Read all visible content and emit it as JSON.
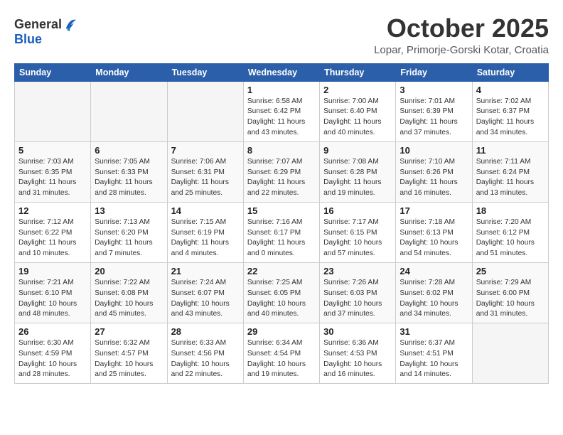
{
  "header": {
    "logo_general": "General",
    "logo_blue": "Blue",
    "month": "October 2025",
    "location": "Lopar, Primorje-Gorski Kotar, Croatia"
  },
  "weekdays": [
    "Sunday",
    "Monday",
    "Tuesday",
    "Wednesday",
    "Thursday",
    "Friday",
    "Saturday"
  ],
  "weeks": [
    [
      {
        "day": "",
        "info": ""
      },
      {
        "day": "",
        "info": ""
      },
      {
        "day": "",
        "info": ""
      },
      {
        "day": "1",
        "info": "Sunrise: 6:58 AM\nSunset: 6:42 PM\nDaylight: 11 hours and 43 minutes."
      },
      {
        "day": "2",
        "info": "Sunrise: 7:00 AM\nSunset: 6:40 PM\nDaylight: 11 hours and 40 minutes."
      },
      {
        "day": "3",
        "info": "Sunrise: 7:01 AM\nSunset: 6:39 PM\nDaylight: 11 hours and 37 minutes."
      },
      {
        "day": "4",
        "info": "Sunrise: 7:02 AM\nSunset: 6:37 PM\nDaylight: 11 hours and 34 minutes."
      }
    ],
    [
      {
        "day": "5",
        "info": "Sunrise: 7:03 AM\nSunset: 6:35 PM\nDaylight: 11 hours and 31 minutes."
      },
      {
        "day": "6",
        "info": "Sunrise: 7:05 AM\nSunset: 6:33 PM\nDaylight: 11 hours and 28 minutes."
      },
      {
        "day": "7",
        "info": "Sunrise: 7:06 AM\nSunset: 6:31 PM\nDaylight: 11 hours and 25 minutes."
      },
      {
        "day": "8",
        "info": "Sunrise: 7:07 AM\nSunset: 6:29 PM\nDaylight: 11 hours and 22 minutes."
      },
      {
        "day": "9",
        "info": "Sunrise: 7:08 AM\nSunset: 6:28 PM\nDaylight: 11 hours and 19 minutes."
      },
      {
        "day": "10",
        "info": "Sunrise: 7:10 AM\nSunset: 6:26 PM\nDaylight: 11 hours and 16 minutes."
      },
      {
        "day": "11",
        "info": "Sunrise: 7:11 AM\nSunset: 6:24 PM\nDaylight: 11 hours and 13 minutes."
      }
    ],
    [
      {
        "day": "12",
        "info": "Sunrise: 7:12 AM\nSunset: 6:22 PM\nDaylight: 11 hours and 10 minutes."
      },
      {
        "day": "13",
        "info": "Sunrise: 7:13 AM\nSunset: 6:20 PM\nDaylight: 11 hours and 7 minutes."
      },
      {
        "day": "14",
        "info": "Sunrise: 7:15 AM\nSunset: 6:19 PM\nDaylight: 11 hours and 4 minutes."
      },
      {
        "day": "15",
        "info": "Sunrise: 7:16 AM\nSunset: 6:17 PM\nDaylight: 11 hours and 0 minutes."
      },
      {
        "day": "16",
        "info": "Sunrise: 7:17 AM\nSunset: 6:15 PM\nDaylight: 10 hours and 57 minutes."
      },
      {
        "day": "17",
        "info": "Sunrise: 7:18 AM\nSunset: 6:13 PM\nDaylight: 10 hours and 54 minutes."
      },
      {
        "day": "18",
        "info": "Sunrise: 7:20 AM\nSunset: 6:12 PM\nDaylight: 10 hours and 51 minutes."
      }
    ],
    [
      {
        "day": "19",
        "info": "Sunrise: 7:21 AM\nSunset: 6:10 PM\nDaylight: 10 hours and 48 minutes."
      },
      {
        "day": "20",
        "info": "Sunrise: 7:22 AM\nSunset: 6:08 PM\nDaylight: 10 hours and 45 minutes."
      },
      {
        "day": "21",
        "info": "Sunrise: 7:24 AM\nSunset: 6:07 PM\nDaylight: 10 hours and 43 minutes."
      },
      {
        "day": "22",
        "info": "Sunrise: 7:25 AM\nSunset: 6:05 PM\nDaylight: 10 hours and 40 minutes."
      },
      {
        "day": "23",
        "info": "Sunrise: 7:26 AM\nSunset: 6:03 PM\nDaylight: 10 hours and 37 minutes."
      },
      {
        "day": "24",
        "info": "Sunrise: 7:28 AM\nSunset: 6:02 PM\nDaylight: 10 hours and 34 minutes."
      },
      {
        "day": "25",
        "info": "Sunrise: 7:29 AM\nSunset: 6:00 PM\nDaylight: 10 hours and 31 minutes."
      }
    ],
    [
      {
        "day": "26",
        "info": "Sunrise: 6:30 AM\nSunset: 4:59 PM\nDaylight: 10 hours and 28 minutes."
      },
      {
        "day": "27",
        "info": "Sunrise: 6:32 AM\nSunset: 4:57 PM\nDaylight: 10 hours and 25 minutes."
      },
      {
        "day": "28",
        "info": "Sunrise: 6:33 AM\nSunset: 4:56 PM\nDaylight: 10 hours and 22 minutes."
      },
      {
        "day": "29",
        "info": "Sunrise: 6:34 AM\nSunset: 4:54 PM\nDaylight: 10 hours and 19 minutes."
      },
      {
        "day": "30",
        "info": "Sunrise: 6:36 AM\nSunset: 4:53 PM\nDaylight: 10 hours and 16 minutes."
      },
      {
        "day": "31",
        "info": "Sunrise: 6:37 AM\nSunset: 4:51 PM\nDaylight: 10 hours and 14 minutes."
      },
      {
        "day": "",
        "info": ""
      }
    ]
  ]
}
